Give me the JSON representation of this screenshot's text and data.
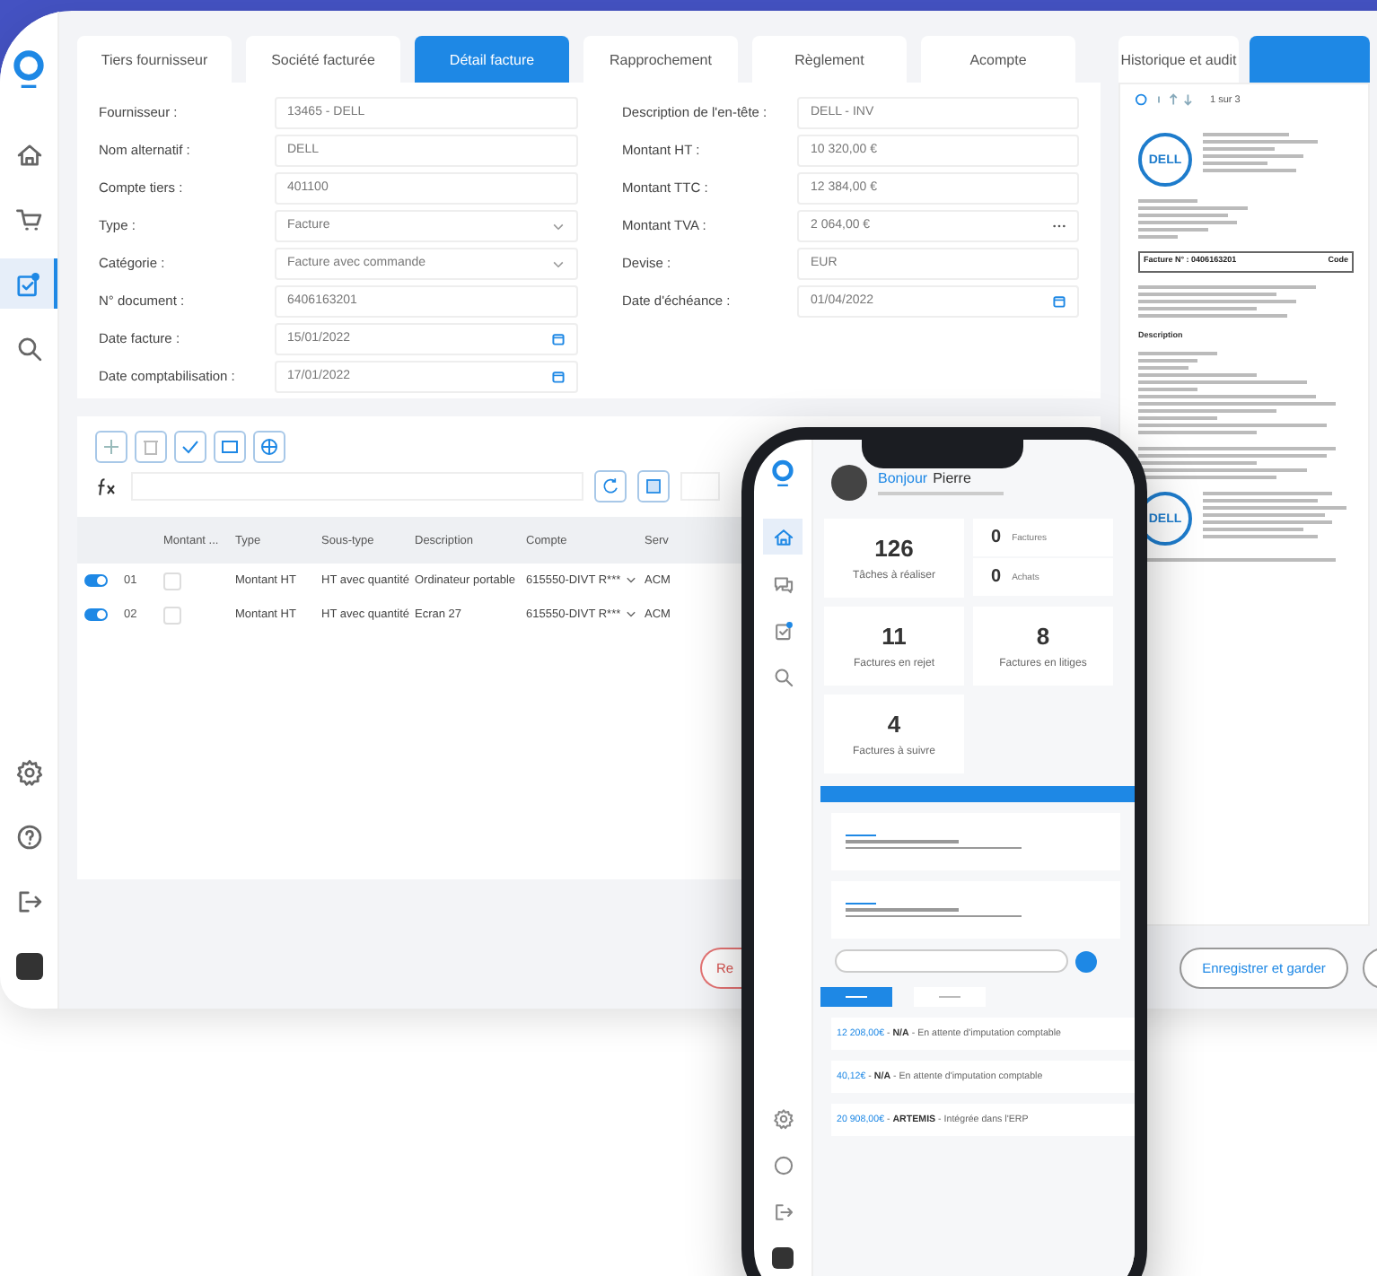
{
  "sidebar": {
    "items": [
      {
        "kind": "home",
        "selected": false
      },
      {
        "kind": "cart",
        "selected": false
      },
      {
        "kind": "tasks",
        "selected": true
      },
      {
        "kind": "search",
        "selected": false
      }
    ],
    "bottom_items": [
      {
        "kind": "gear"
      },
      {
        "kind": "help"
      },
      {
        "kind": "exit"
      },
      {
        "kind": "avatar"
      }
    ]
  },
  "tabs": [
    {
      "label": "Tiers fournisseur",
      "selected": false
    },
    {
      "label": "Société facturée",
      "selected": false
    },
    {
      "label": "Détail facture",
      "selected": true
    },
    {
      "label": "Rapprochement",
      "selected": false
    },
    {
      "label": "Règlement",
      "selected": false
    },
    {
      "label": "Acompte",
      "selected": false
    }
  ],
  "form": {
    "left": [
      {
        "label": "Fournisseur :",
        "value": "13465 - DELL",
        "kind": "text"
      },
      {
        "label": "Nom alternatif :",
        "value": "DELL",
        "kind": "text"
      },
      {
        "label": "Compte tiers :",
        "value": "401100",
        "kind": "text"
      },
      {
        "label": "Type :",
        "value": "Facture",
        "kind": "select"
      },
      {
        "label": "Catégorie :",
        "value": "Facture avec commande",
        "kind": "select"
      },
      {
        "label": "N° document :",
        "value": "6406163201",
        "kind": "text"
      },
      {
        "label": "Date facture :",
        "value": "15/01/2022",
        "kind": "date"
      },
      {
        "label": "Date comptabilisation :",
        "value": "17/01/2022",
        "kind": "date"
      }
    ],
    "right": [
      {
        "label": "Description de l'en-tête :",
        "value": "DELL - INV",
        "kind": "text"
      },
      {
        "label": "Montant HT :",
        "value": "10 320,00 €",
        "kind": "text"
      },
      {
        "label": "Montant TTC :",
        "value": "12 384,00 €",
        "kind": "text"
      },
      {
        "label": "Montant TVA :",
        "value": "2 064,00 €",
        "kind": "more"
      },
      {
        "label": "Devise :",
        "value": "EUR",
        "kind": "text"
      },
      {
        "label": "Date d'échéance :",
        "value": "01/04/2022",
        "kind": "date"
      }
    ]
  },
  "lines_table": {
    "columns": [
      "Montant ...",
      "Type",
      "Sous-type",
      "Description",
      "Compte",
      "Serv"
    ],
    "rows": [
      {
        "enabled": true,
        "checked": false,
        "number": "01",
        "cells": [
          "",
          "Montant HT",
          "HT avec quantité",
          "Ordinateur portable",
          "615550-DIVT R***",
          "ACM"
        ]
      },
      {
        "enabled": true,
        "checked": false,
        "number": "02",
        "cells": [
          "",
          "Montant HT",
          "HT avec quantité",
          "Ecran 27",
          "615550-DIVT R***",
          "ACM"
        ]
      }
    ]
  },
  "buttons": [
    {
      "label": "Re",
      "kind": "danger"
    },
    {
      "label": "Enregistrer et garder",
      "kind": "outline"
    },
    {
      "kind": "outline"
    }
  ],
  "side_panel": {
    "tabs": [
      {
        "label": "Historique et audit",
        "selected": false
      },
      {
        "selected": true
      }
    ],
    "pager": "1 sur 3",
    "document": {
      "logo": "DELL",
      "logo_bottom": "DELL",
      "invoice_number": "Facture N° : 0406163201",
      "code_label": "Code",
      "section": "Description"
    }
  },
  "phone": {
    "greeting": "Bonjour",
    "user": "Pierre",
    "stats": [
      {
        "kind": "big",
        "value": "126",
        "label": "Tâches à réaliser"
      },
      {
        "kind": "pair",
        "items": [
          {
            "value": "0",
            "label": "Factures"
          },
          {
            "value": "0",
            "label": "Achats"
          }
        ]
      },
      {
        "kind": "big",
        "value": "11",
        "label": "Factures en rejet"
      },
      {
        "kind": "big",
        "value": "8",
        "label": "Factures en litiges"
      },
      {
        "kind": "big",
        "value": "4",
        "label": "Factures à suivre"
      }
    ],
    "tabs": [
      {
        "selected": true
      },
      {
        "selected": false
      }
    ],
    "invoices": [
      {
        "amount": "12 208,00€",
        "detail": "- **N/A** - En attente d'imputation comptable"
      },
      {
        "amount": "40,12€",
        "detail": "- **N/A** - En attente d'imputation comptable"
      },
      {
        "amount": "20 908,00€",
        "detail": "- **ARTEMIS** - Intégrée dans l'ERP"
      }
    ]
  }
}
